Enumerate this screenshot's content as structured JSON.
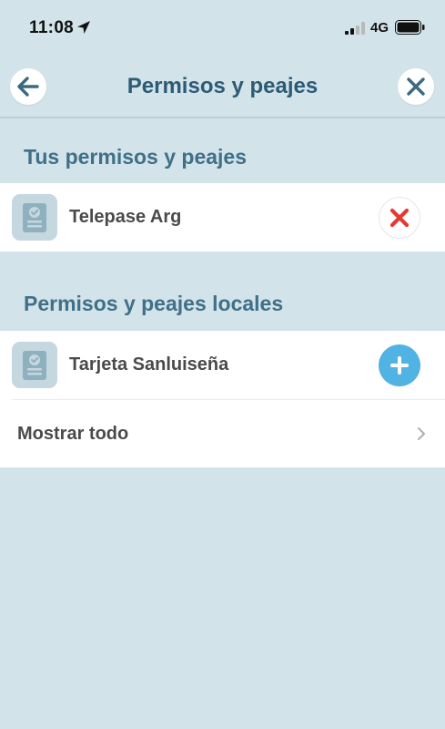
{
  "status_bar": {
    "time": "11:08",
    "network": "4G"
  },
  "header": {
    "title": "Permisos y peajes",
    "back_icon": "arrow-left-icon",
    "close_icon": "close-icon"
  },
  "sections": [
    {
      "title": "Tus permisos y peajes",
      "items": [
        {
          "label": "Telepase Arg",
          "icon": "permit-document-icon",
          "action": "remove",
          "action_color": "#e53935"
        }
      ]
    },
    {
      "title": "Permisos y peajes locales",
      "items": [
        {
          "label": "Tarjeta Sanluiseña",
          "icon": "permit-document-icon",
          "action": "add",
          "action_color": "#51b3e3"
        }
      ],
      "show_all_label": "Mostrar todo"
    }
  ],
  "colors": {
    "background": "#d3e3ea",
    "title": "#2c5b74",
    "section_title": "#3f7088",
    "accent": "#51b3e3",
    "remove": "#e53935"
  }
}
